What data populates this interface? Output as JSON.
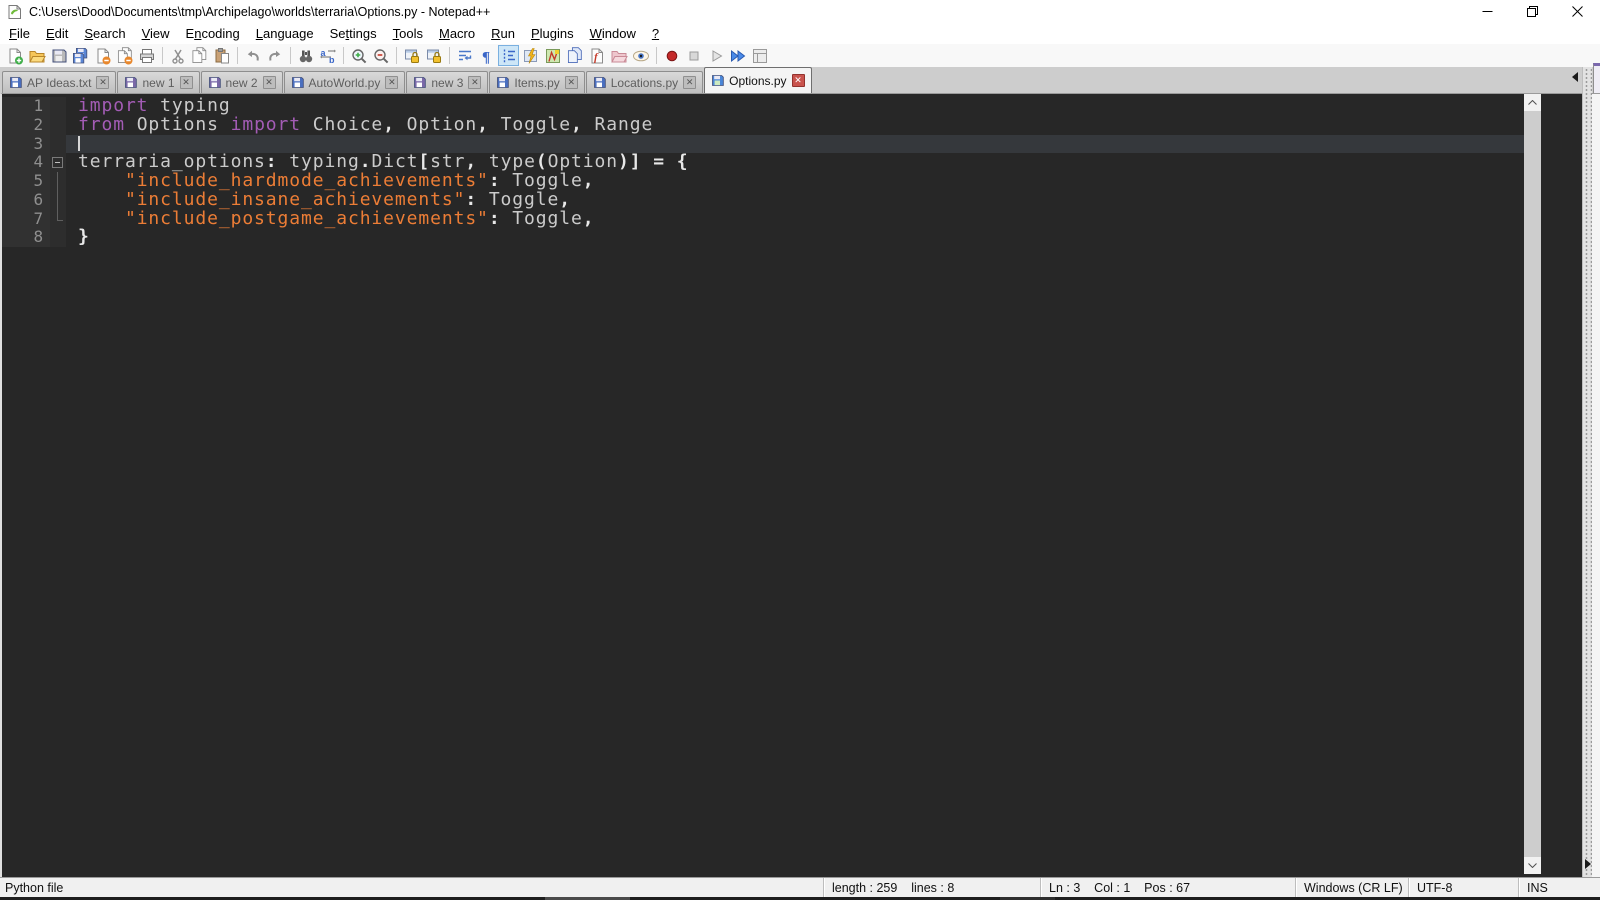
{
  "window": {
    "title": "C:\\Users\\Dood\\Documents\\tmp\\Archipelago\\worlds\\terraria\\Options.py - Notepad++",
    "controls": [
      "minimize",
      "restore",
      "close"
    ]
  },
  "menu": {
    "items": [
      {
        "label": "File",
        "mnemonic": 0
      },
      {
        "label": "Edit",
        "mnemonic": 0
      },
      {
        "label": "Search",
        "mnemonic": 0
      },
      {
        "label": "View",
        "mnemonic": 0
      },
      {
        "label": "Encoding",
        "mnemonic": 1
      },
      {
        "label": "Language",
        "mnemonic": 0
      },
      {
        "label": "Settings",
        "mnemonic": 2
      },
      {
        "label": "Tools",
        "mnemonic": 0
      },
      {
        "label": "Macro",
        "mnemonic": 0
      },
      {
        "label": "Run",
        "mnemonic": 0
      },
      {
        "label": "Plugins",
        "mnemonic": 0
      },
      {
        "label": "Window",
        "mnemonic": 0
      },
      {
        "label": "?",
        "mnemonic": 0
      }
    ]
  },
  "toolbar": {
    "buttons": [
      "new-file",
      "open-folder",
      "save",
      "save-all",
      "close-file",
      "close-all",
      "print",
      "sep",
      "cut",
      "copy",
      "paste",
      "sep",
      "undo",
      "redo",
      "sep",
      "find",
      "replace",
      "sep",
      "zoom-in",
      "zoom-out",
      "sep",
      "sync-vertical-scroll",
      "sync-horizontal-scroll",
      "sep",
      "word-wrap",
      "show-all-characters",
      "show-indent-guide",
      "user-defined-language",
      "document-map",
      "document-list",
      "function-list",
      "folder-as-workspace",
      "monitoring-eye",
      "sep",
      "macro-record",
      "macro-stop",
      "macro-play",
      "macro-run-multiple",
      "macro-save"
    ],
    "pressed": "show-indent-guide",
    "disabled": [
      "save",
      "undo",
      "redo",
      "macro-stop",
      "macro-play",
      "macro-save"
    ]
  },
  "tabs": [
    {
      "label": "AP Ideas.txt",
      "state": "saved",
      "active": false
    },
    {
      "label": "new 1",
      "state": "modified",
      "active": false
    },
    {
      "label": "new 2",
      "state": "modified",
      "active": false
    },
    {
      "label": "AutoWorld.py",
      "state": "saved",
      "active": false
    },
    {
      "label": "new 3",
      "state": "modified",
      "active": false
    },
    {
      "label": "Items.py",
      "state": "saved",
      "active": false
    },
    {
      "label": "Locations.py",
      "state": "saved",
      "active": false
    },
    {
      "label": "Options.py",
      "state": "saved",
      "active": true
    }
  ],
  "editor": {
    "language": "Python",
    "caret": {
      "line": 3,
      "col": 1
    },
    "lines": [
      {
        "n": "1",
        "fold": "",
        "tokens": [
          {
            "t": "import",
            "c": "kw"
          },
          {
            "t": " typing",
            "c": "id"
          }
        ]
      },
      {
        "n": "2",
        "fold": "",
        "tokens": [
          {
            "t": "from",
            "c": "kw"
          },
          {
            "t": " Options ",
            "c": "id"
          },
          {
            "t": "import",
            "c": "kw"
          },
          {
            "t": " Choice",
            "c": "id"
          },
          {
            "t": ",",
            "c": "op"
          },
          {
            "t": " Option",
            "c": "id"
          },
          {
            "t": ",",
            "c": "op"
          },
          {
            "t": " Toggle",
            "c": "id"
          },
          {
            "t": ",",
            "c": "op"
          },
          {
            "t": " Range",
            "c": "id"
          }
        ]
      },
      {
        "n": "3",
        "fold": "",
        "current": true,
        "caret": true,
        "tokens": []
      },
      {
        "n": "4",
        "fold": "start",
        "tokens": [
          {
            "t": "terraria_options",
            "c": "id"
          },
          {
            "t": ":",
            "c": "op"
          },
          {
            "t": " typing",
            "c": "id"
          },
          {
            "t": ".",
            "c": "op"
          },
          {
            "t": "Dict",
            "c": "id"
          },
          {
            "t": "[",
            "c": "op"
          },
          {
            "t": "str",
            "c": "id"
          },
          {
            "t": ",",
            "c": "op"
          },
          {
            "t": " type",
            "c": "id"
          },
          {
            "t": "(",
            "c": "op"
          },
          {
            "t": "Option",
            "c": "id"
          },
          {
            "t": ")]",
            "c": "op"
          },
          {
            "t": " = {",
            "c": "op"
          }
        ]
      },
      {
        "n": "5",
        "fold": "line",
        "tokens": [
          {
            "t": "    ",
            "c": "id"
          },
          {
            "t": "\"include_hardmode_achievements\"",
            "c": "str"
          },
          {
            "t": ":",
            "c": "op"
          },
          {
            "t": " Toggle",
            "c": "id"
          },
          {
            "t": ",",
            "c": "op"
          }
        ]
      },
      {
        "n": "6",
        "fold": "line",
        "tokens": [
          {
            "t": "    ",
            "c": "id"
          },
          {
            "t": "\"include_insane_achievements\"",
            "c": "str"
          },
          {
            "t": ":",
            "c": "op"
          },
          {
            "t": " Toggle",
            "c": "id"
          },
          {
            "t": ",",
            "c": "op"
          }
        ]
      },
      {
        "n": "7",
        "fold": "end",
        "tokens": [
          {
            "t": "    ",
            "c": "id"
          },
          {
            "t": "\"include_postgame_achievements\"",
            "c": "str"
          },
          {
            "t": ":",
            "c": "op"
          },
          {
            "t": " Toggle",
            "c": "id"
          },
          {
            "t": ",",
            "c": "op"
          }
        ]
      },
      {
        "n": "8",
        "fold": "",
        "tokens": [
          {
            "t": "}",
            "c": "op"
          }
        ]
      }
    ],
    "colors": {
      "background": "#272727",
      "margin_background": "#313131",
      "line_number": "#8f8f8f",
      "keyword": "#a35cb5",
      "identifier": "#cbcbcb",
      "string": "#ec7d36",
      "operator": "#e8e8e8",
      "current_line": "#35383c"
    }
  },
  "statusbar": {
    "doc_type": "Python file",
    "length_label": "length : 259",
    "lines_label": "lines : 8",
    "ln_label": "Ln : 3",
    "col_label": "Col : 1",
    "pos_label": "Pos : 67",
    "eol": "Windows (CR LF)",
    "encoding": "UTF-8",
    "insert_mode": "INS"
  }
}
